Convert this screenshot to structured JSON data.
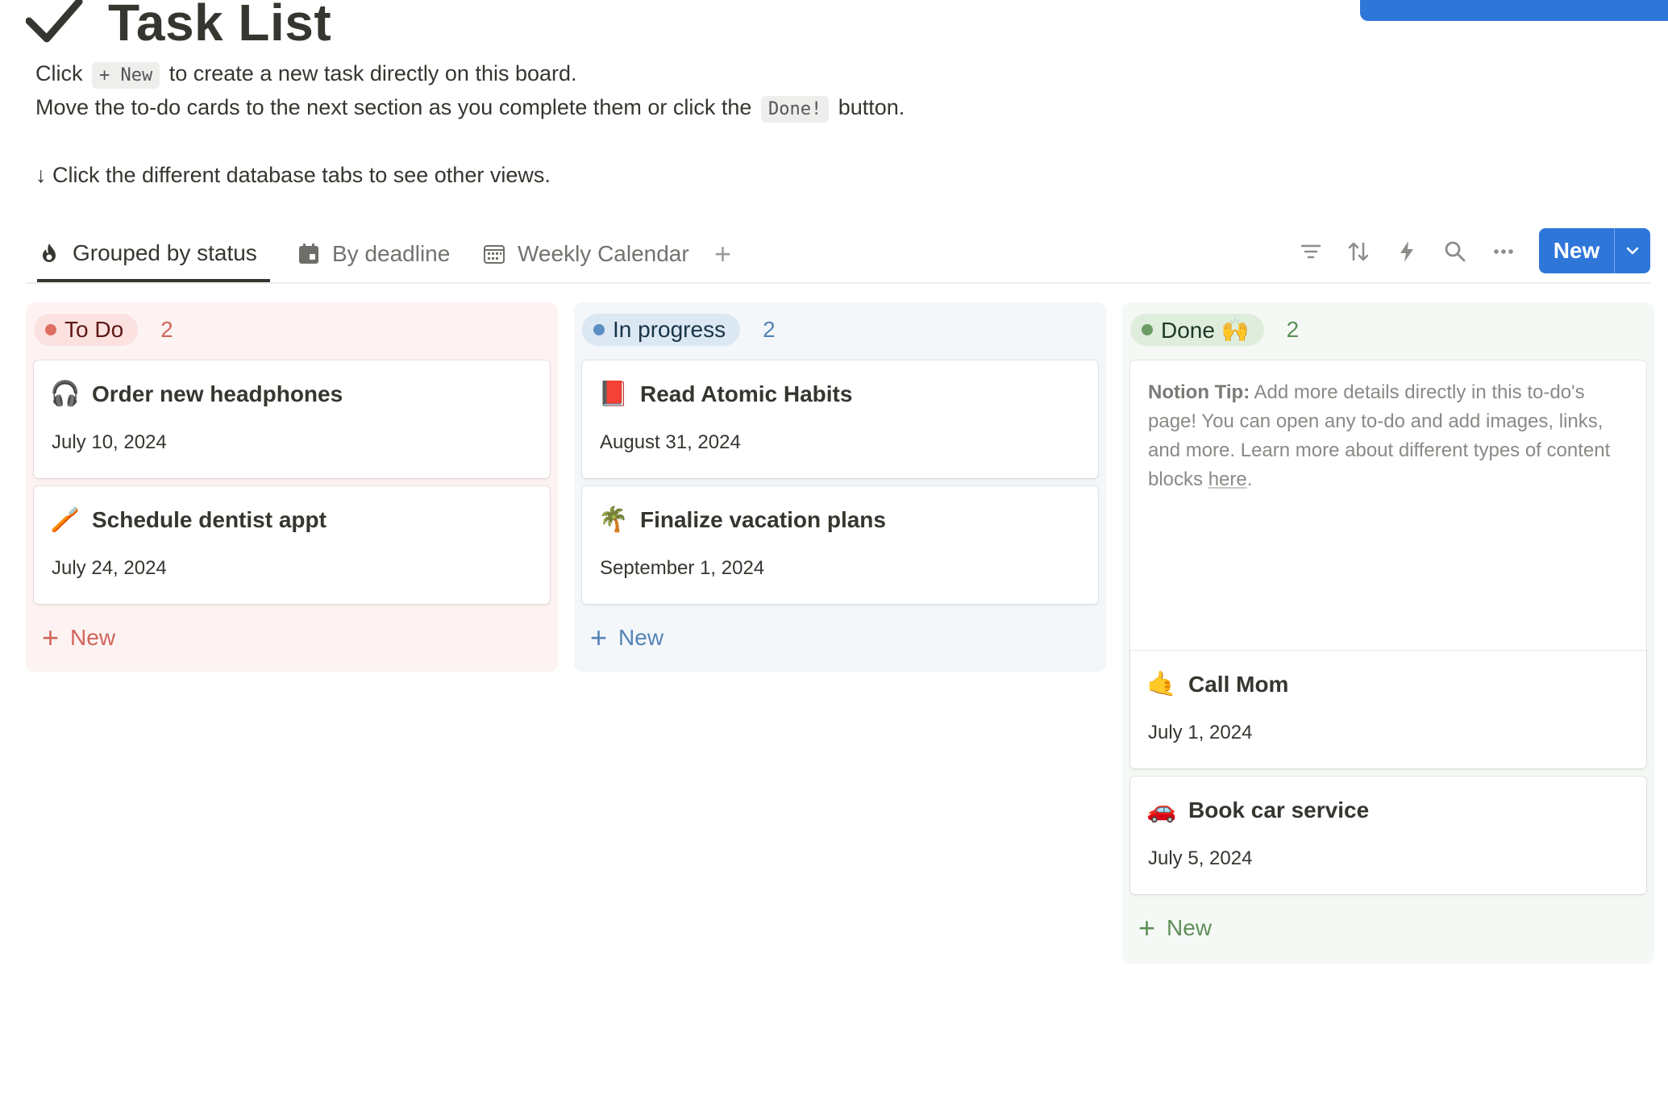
{
  "page": {
    "title": "Task List",
    "line1_pre": "Click",
    "line1_code": "+ New",
    "line1_post": "to create a new task directly on this board.",
    "line2_pre": "Move the to-do cards to the next section as you complete them or click the",
    "line2_code": "Done!",
    "line2_post": "button.",
    "line3": "↓ Click the different database tabs to see other views."
  },
  "tabs": [
    {
      "label": "Grouped by status",
      "icon": "fire-icon",
      "active": true
    },
    {
      "label": "By deadline",
      "icon": "calendar-icon",
      "active": false
    },
    {
      "label": "Weekly Calendar",
      "icon": "calendar-grid-icon",
      "active": false
    }
  ],
  "toolbar": {
    "add_tab": "+",
    "new_label": "New",
    "icons": [
      "filter-icon",
      "sort-icon",
      "automation-icon",
      "search-icon",
      "more-icon"
    ]
  },
  "columns": [
    {
      "name": "To Do",
      "count": "2",
      "colors": {
        "pill_bg": "#fbe2e0",
        "dot": "#de6f63",
        "text": "#5d1715",
        "count": "#d2655a",
        "new": "#d2655a"
      },
      "cards": [
        {
          "emoji": "🎧",
          "title": "Order new headphones",
          "date": "July 10, 2024"
        },
        {
          "emoji": "🪥",
          "title": "Schedule dentist appt",
          "date": "July 24, 2024"
        }
      ],
      "new_label": "New"
    },
    {
      "name": "In progress",
      "count": "2",
      "colors": {
        "pill_bg": "#dbe7f2",
        "dot": "#5b8fc2",
        "text": "#183347",
        "count": "#5583b5",
        "new": "#5583b5"
      },
      "cards": [
        {
          "emoji": "📕",
          "title": "Read Atomic Habits",
          "date": "August 31, 2024"
        },
        {
          "emoji": "🌴",
          "title": "Finalize vacation plans",
          "date": "September 1, 2024"
        }
      ],
      "new_label": "New"
    },
    {
      "name": "Done 🙌",
      "count": "2",
      "colors": {
        "pill_bg": "#dfeddc",
        "dot": "#6c9b66",
        "text": "#1c3829",
        "count": "#5e8f59",
        "new": "#5e8f59"
      },
      "tip": {
        "label": "Notion Tip:",
        "text": "Add more details directly in this to-do's page! You can open any to-do and add images, links, and more. Learn more about different types of content blocks",
        "link": "here",
        "end": "."
      },
      "cards": [
        {
          "emoji": "🤙",
          "title": "Call Mom",
          "date": "July 1, 2024"
        },
        {
          "emoji": "🚗",
          "title": "Book car service",
          "date": "July 5, 2024"
        }
      ],
      "new_label": "New"
    }
  ]
}
